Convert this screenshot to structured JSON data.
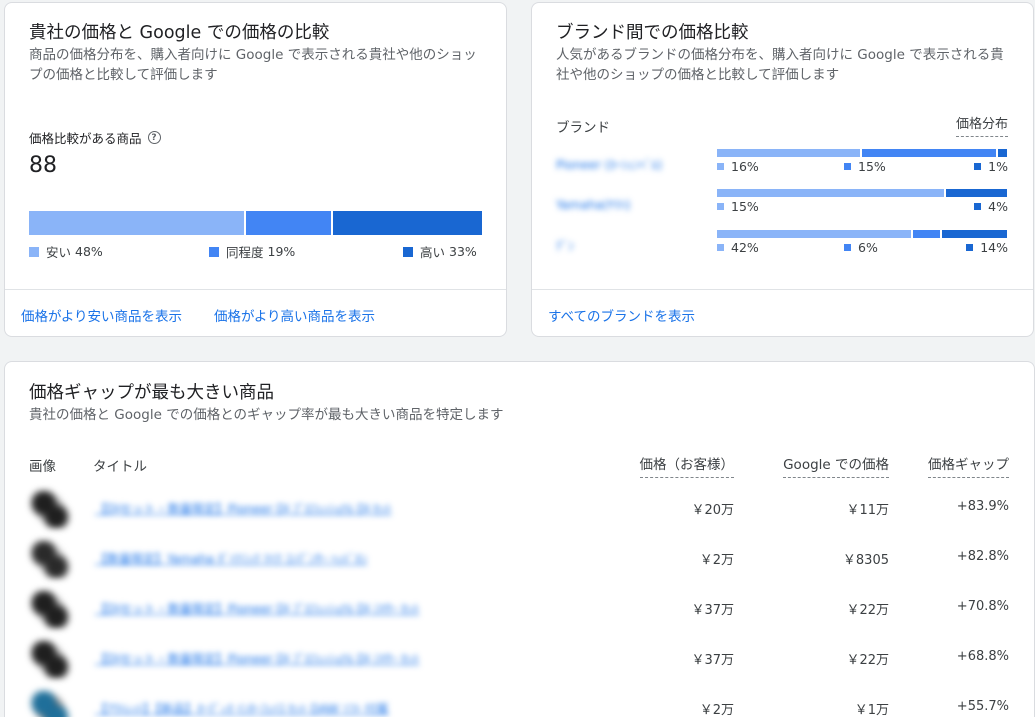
{
  "own_price": {
    "title": "貴社の価格と Google での価格の比較",
    "subtitle": "商品の価格分布を、購入者向けに Google で表示される貴社や他のショップの価格と比較して評価します",
    "metric_label": "価格比較がある商品",
    "metric_value": "88",
    "distribution": [
      {
        "label": "安い",
        "pct": 48,
        "pct_text": "48%",
        "color": "#8ab4f8"
      },
      {
        "label": "同程度",
        "pct": 19,
        "pct_text": "19%",
        "color": "#4285f4"
      },
      {
        "label": "高い",
        "pct": 33,
        "pct_text": "33%",
        "color": "#1967d2"
      }
    ],
    "link_cheaper": "価格がより安い商品を表示",
    "link_higher": "価格がより高い商品を表示"
  },
  "brand_compare": {
    "title": "ブランド間での価格比較",
    "subtitle": "人気があるブランドの価格分布を、購入者向けに Google で表示される貴社や他のショップの価格と比較して評価します",
    "col_brand": "ブランド",
    "col_distribution": "価格分布",
    "rows": [
      {
        "name": "Pioneer (ｶｰｼｪﾝﾍﾞﾙ)",
        "low": 16,
        "low_text": "16%",
        "mid": 15,
        "mid_text": "15%",
        "high": 1,
        "high_text": "1%"
      },
      {
        "name": "Yamaha(ﾔﾏﾊ)",
        "low": 15,
        "low_text": "15%",
        "mid": null,
        "mid_text": "",
        "high": 4,
        "high_text": "4%"
      },
      {
        "name": "ﾃﾞﾝ",
        "low": 42,
        "low_text": "42%",
        "mid": 6,
        "mid_text": "6%",
        "high": 14,
        "high_text": "14%"
      }
    ],
    "link_all": "すべてのブランドを表示"
  },
  "gap_products": {
    "title": "価格ギャップが最も大きい商品",
    "subtitle": "貴社の価格と Google での価格とのギャップ率が最も大きい商品を特定します",
    "headers": {
      "image": "画像",
      "title": "タイトル",
      "price": "価格（お客様）",
      "google_price": "Google での価格",
      "gap": "価格ギャップ"
    },
    "rows": [
      {
        "title": "【DJセット・数量限定】Pioneer DJ ﾌﾟﾛﾌｪｯｼｮﾅﾙ DJ ｾｯﾄ",
        "price": "￥20万",
        "google_price": "￥11万",
        "gap": "+83.9%"
      },
      {
        "title": "【数量限定】Yamaha ﾀﾞｲﾅﾐｯｸ ﾏｲｸ ｺﾝﾃﾞﾝｻｰ ﾍｯﾄﾞﾎﾝ",
        "price": "￥2万",
        "google_price": "￥8305",
        "gap": "+82.8%"
      },
      {
        "title": "【DJセット・数量限定】Pioneer DJ ﾌﾟﾛﾌｪｯｼｮﾅﾙ DJ ﾐｷｻｰ ｾｯﾄ",
        "price": "￥37万",
        "google_price": "￥22万",
        "gap": "+70.8%"
      },
      {
        "title": "【DJセット・数量限定】Pioneer DJ ﾌﾟﾛﾌｪｯｼｮﾅﾙ DJ ﾐｷｻｰ ｾｯﾄ",
        "price": "￥37万",
        "google_price": "￥22万",
        "gap": "+68.8%"
      },
      {
        "title": "【ｱｳﾄﾚｯﾄ】【新品】ｵｰﾃﾞｨｵ ｲﾝﾀｰﾌｪｲｽ ｾｯﾄ DAW ｿﾌﾄ 付属",
        "price": "￥2万",
        "google_price": "￥1万",
        "gap": "+55.7%"
      }
    ]
  }
}
